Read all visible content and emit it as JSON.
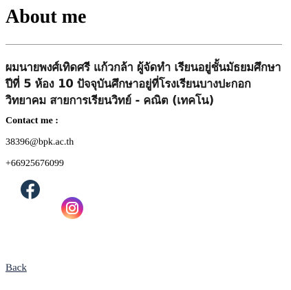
{
  "page": {
    "title": "About me"
  },
  "bio": {
    "text": "ผมนายพงศ์เทิดศรี แก้วกล้า ผู้จัดทำ เรียนอยู่ชั้นมัธยมศึกษาปีที่ 5 ห้อง 10 ปัจจุบันศึกษาอยู่ที่โรงเรียนบางปะกอกวิทยาคม สายการเรียนวิทย์ - คณิต (เทคโน)"
  },
  "contact": {
    "heading": "Contact me :",
    "email": "38396@bpk.ac.th",
    "phone": "+66925676099"
  },
  "social": {
    "facebook_icon": "facebook-icon",
    "instagram_icon": "instagram-icon",
    "facebook_color": "#1f3a55"
  },
  "nav": {
    "back_label": "Back"
  }
}
